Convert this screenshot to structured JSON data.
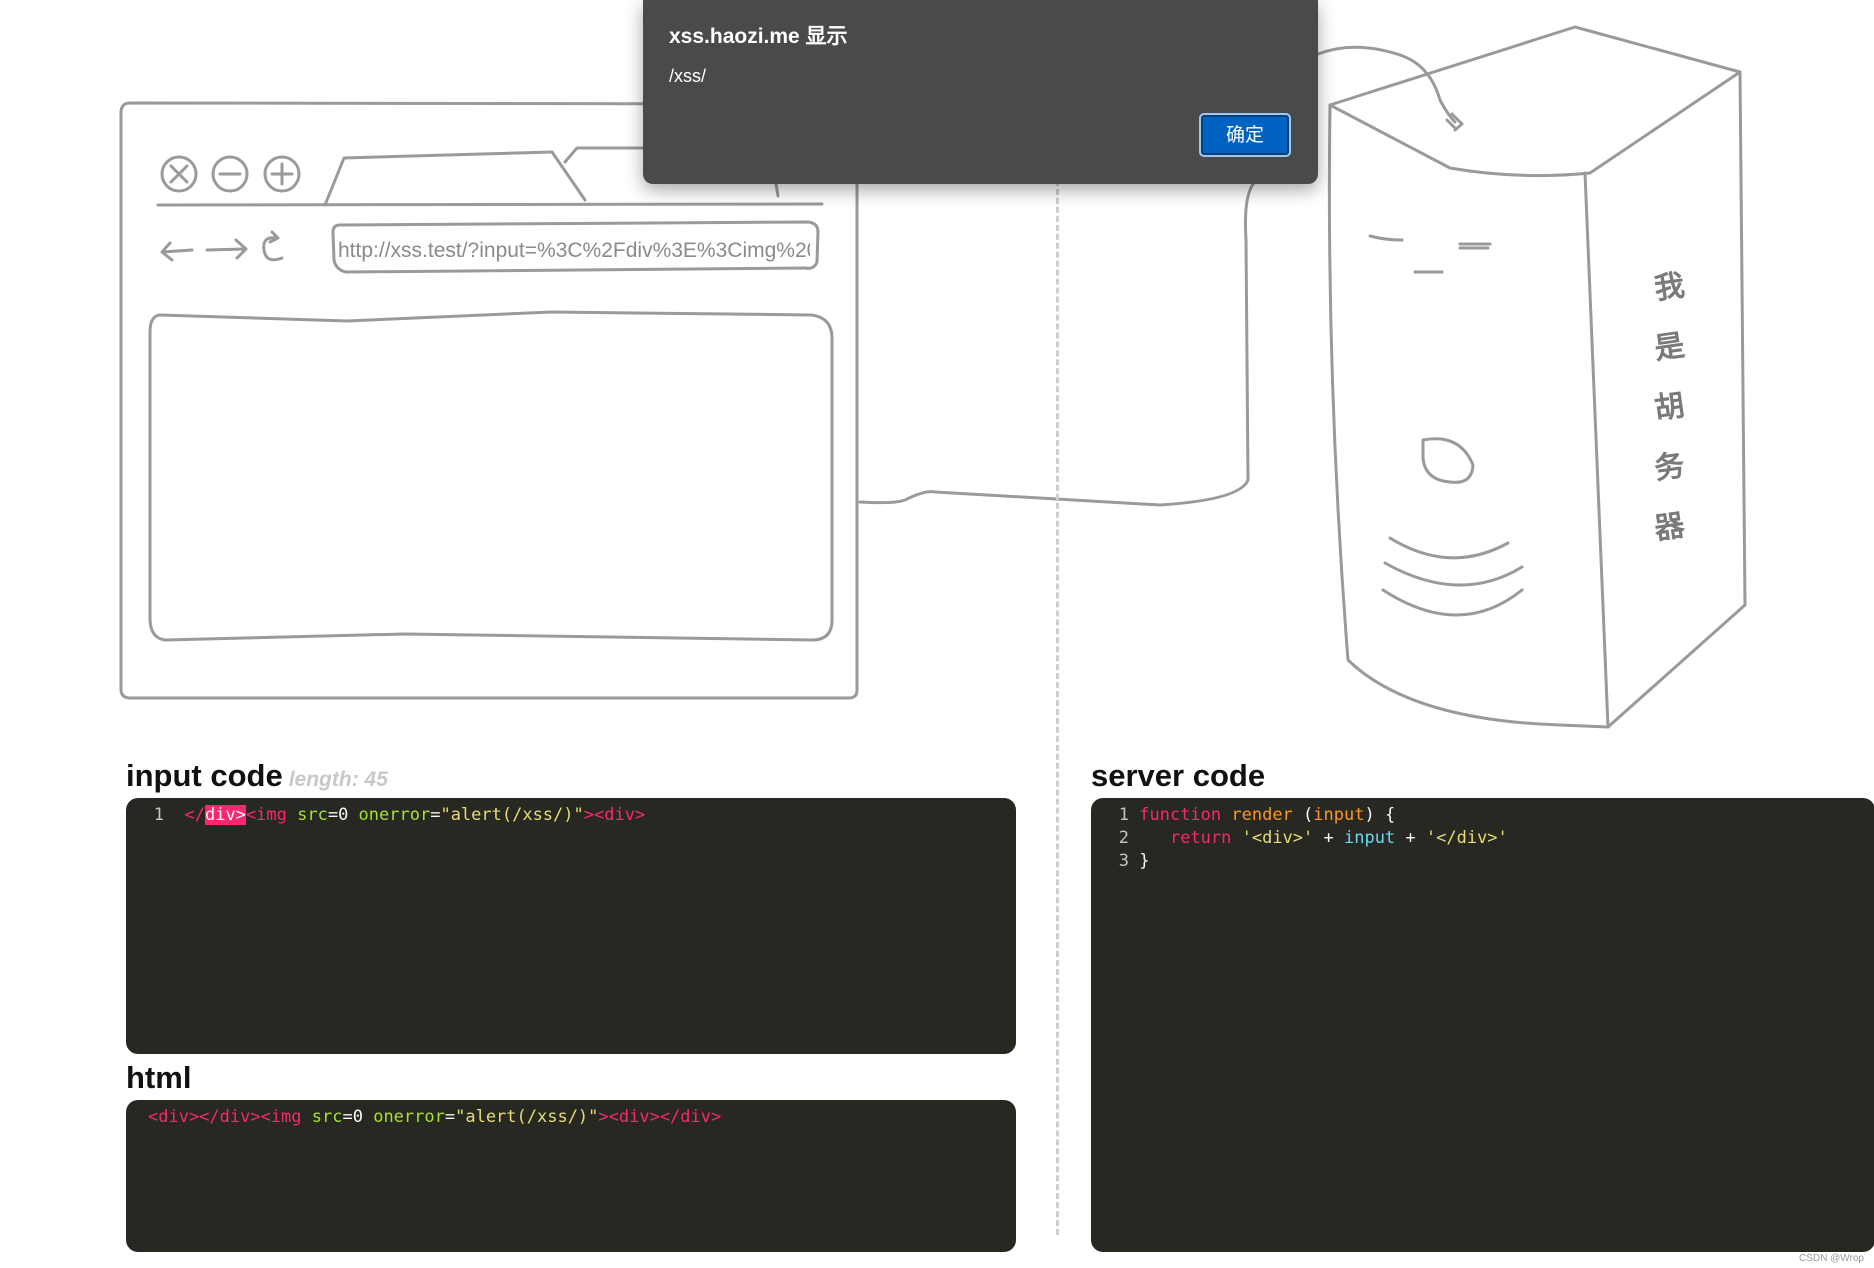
{
  "browser": {
    "url": "http://xss.test/?input=%3C%2Fdiv%3E%3Cimg%20s"
  },
  "server": {
    "face_chars": [
      "我",
      "是",
      "胡",
      "务",
      "器"
    ]
  },
  "input_code": {
    "title": "input code",
    "length_label": "length: 45",
    "line_number": "1",
    "tokens": {
      "t1": "</",
      "t2": "div>",
      "t3": "<img",
      "t4": " src",
      "t5": "=0",
      "t6": " onerror",
      "t7": "=",
      "t8": "\"alert(/xss/)\"",
      "t9": "><div>"
    }
  },
  "html_section": {
    "title": "html",
    "tokens": {
      "t1": "<div></div><img",
      "t2": " src",
      "t3": "=0",
      "t4": " onerror",
      "t5": "=",
      "t6": "\"alert(/xss/)\"",
      "t7": "><div></div>"
    }
  },
  "server_code": {
    "title": "server code",
    "lines": [
      {
        "n": "1",
        "kw": "function",
        "fn": " render",
        "rest1": " (",
        "par": "input",
        "rest2": ") {"
      },
      {
        "n": "2",
        "kw": "return",
        "str1": " '<div>'",
        "op1": " + ",
        "var": "input",
        "op2": " + ",
        "str2": "'</div>'"
      },
      {
        "n": "3",
        "brace": "}"
      }
    ]
  },
  "dialog": {
    "title": "xss.haozi.me 显示",
    "message": "/xss/",
    "ok_label": "确定"
  },
  "watermark": "CSDN @Wrop",
  "colors": {
    "editor_bg": "#272822",
    "dialog_bg": "#4a4a4a",
    "ok_button": "#0063c1",
    "sketch_stroke": "#999999"
  }
}
